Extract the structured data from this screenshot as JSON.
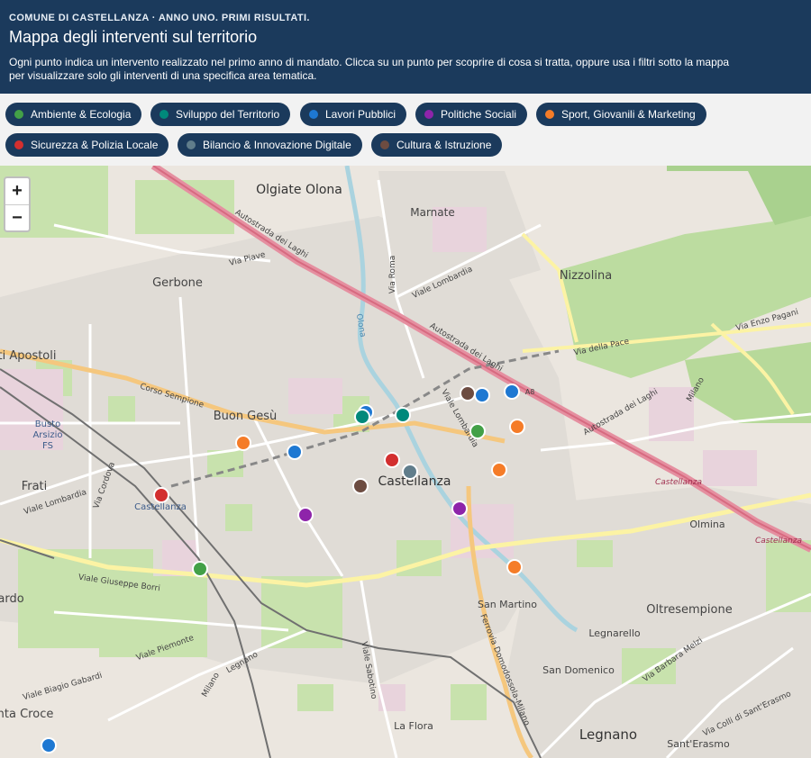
{
  "header": {
    "kicker": "COMUNE DI CASTELLANZA · ANNO UNO. PRIMI RISULTATI.",
    "title": "Mappa degli interventi sul territorio",
    "description_line1": "Ogni punto indica un intervento realizzato nel primo anno di mandato. Clicca su un punto per scoprire di cosa si tratta, oppure usa i filtri sotto la mappa",
    "description_line2": "per visualizzare solo gli interventi di una specifica area tematica."
  },
  "filters": [
    {
      "label": "Ambiente & Ecologia",
      "color": "#43a047"
    },
    {
      "label": "Sviluppo del Territorio",
      "color": "#00897b"
    },
    {
      "label": "Lavori Pubblici",
      "color": "#1e78d2"
    },
    {
      "label": "Politiche Sociali",
      "color": "#8e24aa"
    },
    {
      "label": "Sport, Giovanili & Marketing",
      "color": "#f57c28"
    },
    {
      "label": "Sicurezza & Polizia Locale",
      "color": "#d32f2f"
    },
    {
      "label": "Bilancio & Innovazione Digitale",
      "color": "#607d8b"
    },
    {
      "label": "Cultura & Istruzione",
      "color": "#6d4c41"
    }
  ],
  "zoom": {
    "in": "+",
    "out": "−"
  },
  "places": {
    "olgiate": "Olgiate Olona",
    "marnate": "Marnate",
    "nizzolina": "Nizzolina",
    "gerbone": "Gerbone",
    "apostoli": "ti Apostoli",
    "buon_gesu": "Buon Gesù",
    "busto1": "Busto",
    "busto2": "Arsizio",
    "busto3": "FS",
    "frati": "Frati",
    "castellanza": "Castellanza",
    "castellanza_station": "Castellanza",
    "olmina": "Olmina",
    "san_martino": "San Martino",
    "oltresempione": "Oltresempione",
    "legnarello": "Legnarello",
    "san_domenico": "San Domenico",
    "legnano": "Legnano",
    "santerasmo": "Sant'Erasmo",
    "la_flora": "La Flora",
    "ardo": "ardo",
    "santa_croce": "nta Croce",
    "castellanza_east1": "Castellanza",
    "castellanza_east2": "Castellanza"
  },
  "streets": {
    "autostrada1": "Autostrada dei Laghi",
    "autostrada2": "Autostrada dei Laghi",
    "autostrada3": "Autostrada dei Laghi",
    "a8": "A8",
    "via_piave": "Via Piave",
    "via_roma": "Via Roma",
    "viale_lombardia_n": "Viale Lombardia",
    "via_della_pace": "Via della Pace",
    "via_enzo_pagani": "Via Enzo Pagani",
    "corso_sempione": "Corso Sempione",
    "viale_lombardia_c": "Viale Lombardia",
    "viale_lombardia_w": "Viale Lombardia",
    "via_cordova": "Via Cordova",
    "viale_borri": "Viale Giuseppe Borri",
    "viale_piemonte": "Viale Piemonte",
    "viale_gabardi": "Viale Biagio Gabardi",
    "viale_sabotino": "Viale Sabotino",
    "ferrovia": "Ferrovia Domodossola-Milano",
    "via_barbara_melzi": "Via Barbara Melzi",
    "via_colli": "Via Colli di Sant'Erasmo",
    "olona": "Olona",
    "milano1": "Milano",
    "milano2": "Milano",
    "legnano_st": "Legnano"
  },
  "markers": [
    {
      "category": "Cultura & Istruzione",
      "color": "#6d4c41"
    },
    {
      "category": "Lavori Pubblici",
      "color": "#1e78d2"
    },
    {
      "category": "Lavori Pubblici",
      "color": "#1e78d2"
    },
    {
      "category": "Lavori Pubblici",
      "color": "#1e78d2"
    },
    {
      "category": "Sviluppo del Territorio",
      "color": "#00897b"
    },
    {
      "category": "Sviluppo del Territorio",
      "color": "#00897b"
    },
    {
      "category": "Ambiente & Ecologia",
      "color": "#43a047"
    },
    {
      "category": "Sport, Giovanili & Marketing",
      "color": "#f57c28"
    },
    {
      "category": "Sport, Giovanili & Marketing",
      "color": "#f57c28"
    },
    {
      "category": "Lavori Pubblici",
      "color": "#1e78d2"
    },
    {
      "category": "Sicurezza & Polizia Locale",
      "color": "#d32f2f"
    },
    {
      "category": "Bilancio & Innovazione Digitale",
      "color": "#607d8b"
    },
    {
      "category": "Sport, Giovanili & Marketing",
      "color": "#f57c28"
    },
    {
      "category": "Cultura & Istruzione",
      "color": "#6d4c41"
    },
    {
      "category": "Sicurezza & Polizia Locale",
      "color": "#d32f2f"
    },
    {
      "category": "Politiche Sociali",
      "color": "#8e24aa"
    },
    {
      "category": "Politiche Sociali",
      "color": "#8e24aa"
    },
    {
      "category": "Ambiente & Ecologia",
      "color": "#43a047"
    },
    {
      "category": "Sport, Giovanili & Marketing",
      "color": "#f57c28"
    },
    {
      "category": "Lavori Pubblici",
      "color": "#1e78d2"
    }
  ]
}
